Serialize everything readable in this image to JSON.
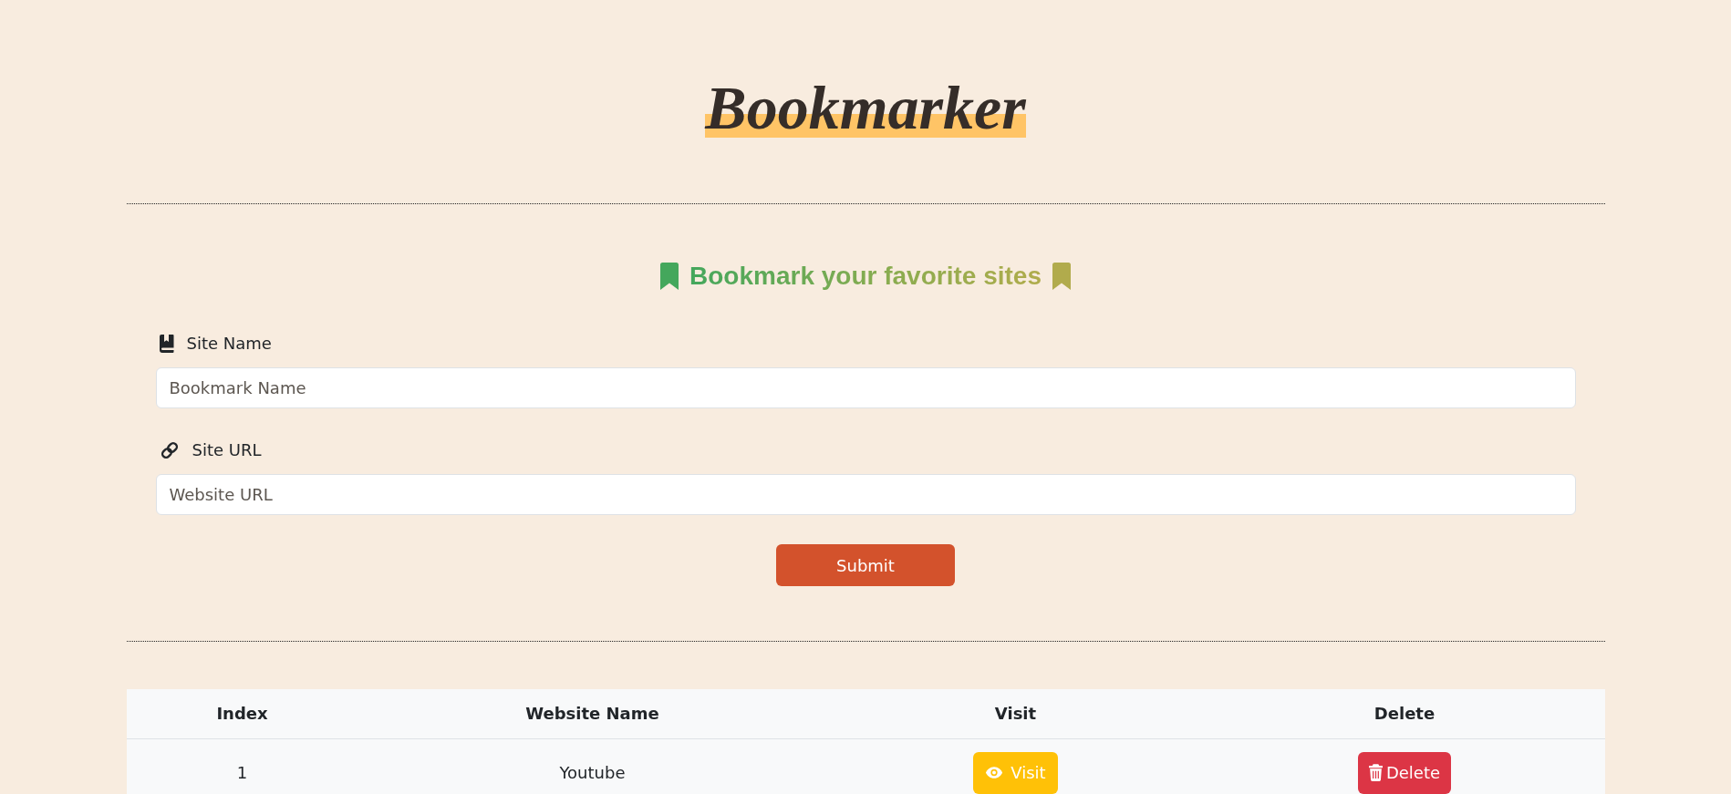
{
  "header": {
    "title": "Bookmarker"
  },
  "form": {
    "heading": "Bookmark your favorite sites",
    "fields": [
      {
        "kind": "name",
        "label": "Site Name",
        "placeholder": "Bookmark Name"
      },
      {
        "kind": "url",
        "label": "Site URL",
        "placeholder": "Website URL"
      }
    ],
    "submit": "Submit"
  },
  "table": {
    "columns": [
      "Index",
      "Website Name",
      "Visit",
      "Delete"
    ],
    "rows": [
      {
        "index": "1",
        "site_name": "Youtube",
        "visit_label": "Visit",
        "delete_label": "Delete"
      }
    ]
  }
}
